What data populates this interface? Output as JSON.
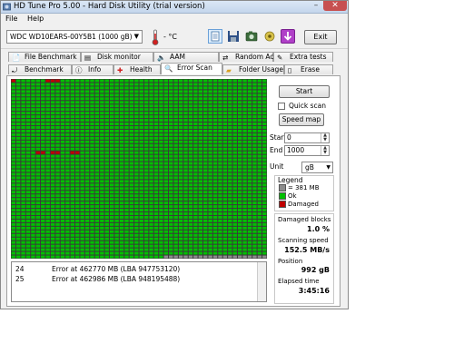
{
  "window": {
    "title": "HD Tune Pro 5.00 - Hard Disk Utility (trial version)"
  },
  "menu": [
    "File",
    "Help"
  ],
  "toolbar": {
    "drive": "WDC WD10EARS-00Y5B1   (1000 gB)",
    "temperature": "- °C",
    "exit_label": "Exit"
  },
  "tabs_top": [
    "File Benchmark",
    "Disk monitor",
    "AAM",
    "Random Access",
    "Extra tests"
  ],
  "tabs_bottom": [
    "Benchmark",
    "Info",
    "Health",
    "Error Scan",
    "Folder Usage",
    "Erase"
  ],
  "active_tab": "Error Scan",
  "controls": {
    "start_label": "Start",
    "quick_scan_label": "Quick scan",
    "speed_map_label": "Speed map",
    "start_field_label": "Start",
    "start_value": "0",
    "end_field_label": "End",
    "end_value": "1000",
    "unit_label": "Unit",
    "unit_value": "gB"
  },
  "legend": {
    "title": "Legend",
    "block_size": "= 381 MB",
    "ok": "Ok",
    "damaged": "Damaged"
  },
  "stats": {
    "damaged_blocks_label": "Damaged blocks",
    "damaged_blocks": "1.0 %",
    "scanning_speed_label": "Scanning speed",
    "scanning_speed": "152.5 MB/s",
    "position_label": "Position",
    "position": "992 gB",
    "elapsed_label": "Elapsed time",
    "elapsed": "3:45:16"
  },
  "log": [
    {
      "n": "24",
      "text": "Error at 462770 MB (LBA 947753120)"
    },
    {
      "n": "25",
      "text": "Error at 462986 MB (LBA 948195488)"
    }
  ],
  "scan_grid": {
    "columns": 52,
    "rows": 50,
    "scanned_fraction": 0.992,
    "damaged_blocks": [
      [
        0,
        0
      ],
      [
        0,
        7
      ],
      [
        0,
        8
      ],
      [
        0,
        9
      ],
      [
        20,
        5
      ],
      [
        20,
        6
      ],
      [
        20,
        8
      ],
      [
        20,
        9
      ],
      [
        20,
        12
      ],
      [
        20,
        13
      ]
    ],
    "colors": {
      "ok": "#00c000",
      "damaged": "#c00000",
      "unscanned": "#8c8c8c",
      "gridline": "#3a3a3a"
    }
  }
}
